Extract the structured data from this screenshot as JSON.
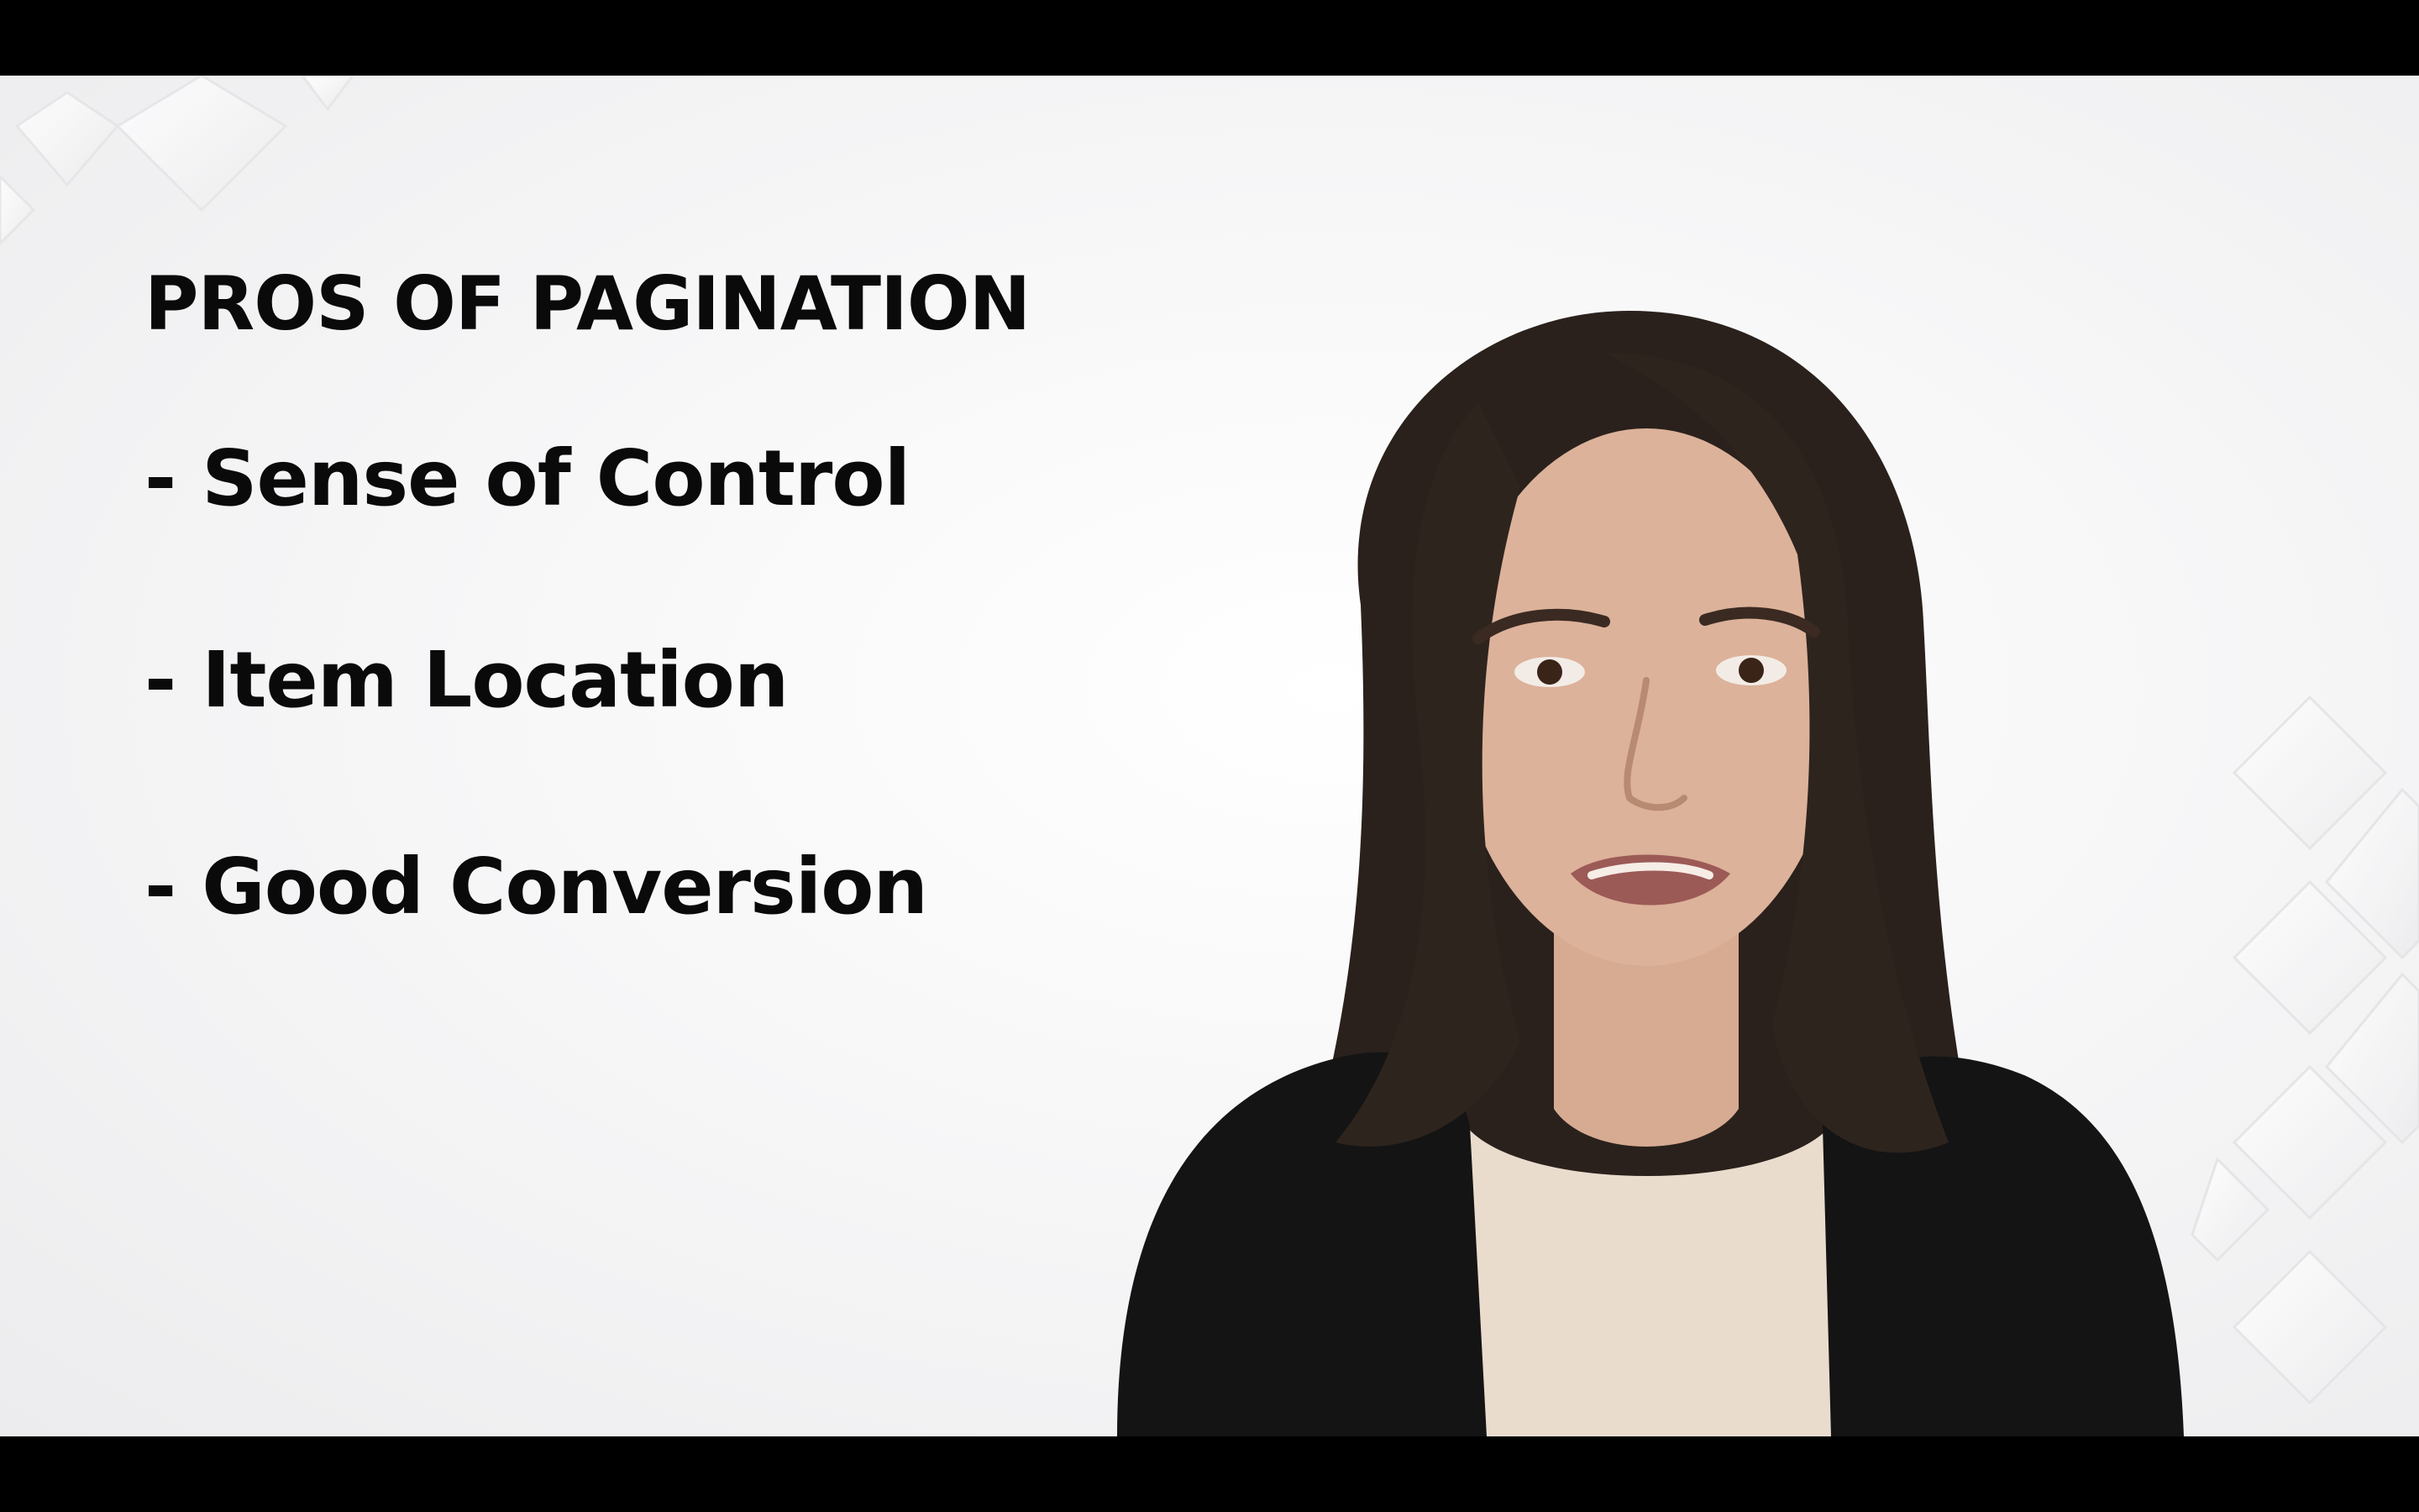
{
  "slide": {
    "title": "PROS OF PAGINATION",
    "bullets": [
      "- Sense of Control",
      "- Item Location",
      "- Good Conversion"
    ]
  },
  "colors": {
    "letterbox": "#000000",
    "background": "#f4f4f5",
    "text": "#0a0a0a",
    "jacket": "#141414",
    "hair": "#2a211c",
    "skin": "#dcb29a",
    "top": "#eadccd"
  }
}
